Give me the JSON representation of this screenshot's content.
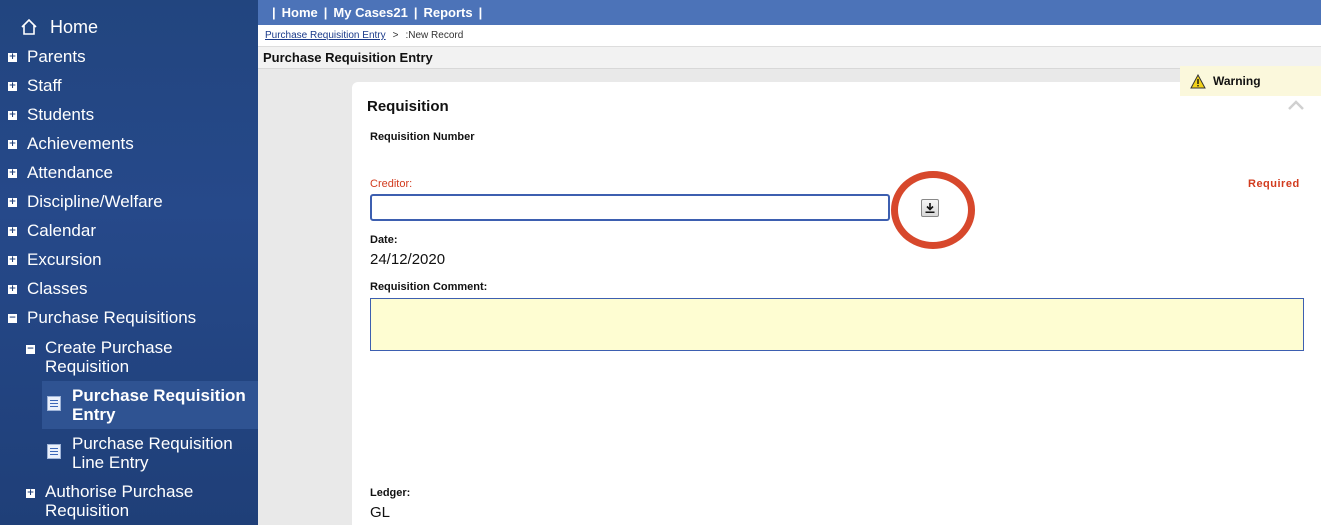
{
  "sidebar": {
    "home": "Home",
    "items": [
      {
        "label": "Parents",
        "toggle": "+"
      },
      {
        "label": "Staff",
        "toggle": "+"
      },
      {
        "label": "Students",
        "toggle": "+"
      },
      {
        "label": "Achievements",
        "toggle": "+"
      },
      {
        "label": "Attendance",
        "toggle": "+"
      },
      {
        "label": "Discipline/Welfare",
        "toggle": "+"
      },
      {
        "label": "Calendar",
        "toggle": "+"
      },
      {
        "label": "Excursion",
        "toggle": "+"
      },
      {
        "label": "Classes",
        "toggle": "+"
      },
      {
        "label": "Purchase Requisitions",
        "toggle": "−"
      }
    ],
    "sub": {
      "create": {
        "label": "Create Purchase Requisition",
        "toggle": "−"
      },
      "leaves": [
        {
          "label": "Purchase Requisition Entry",
          "active": true
        },
        {
          "label": "Purchase Requisition Line Entry",
          "active": false
        }
      ],
      "authorise": {
        "label": "Authorise Purchase Requisition",
        "toggle": "+"
      }
    }
  },
  "topnav": {
    "sep": "|",
    "home": "Home",
    "my_cases": "My Cases21",
    "reports": "Reports"
  },
  "breadcrumb": {
    "link": "Purchase Requisition Entry",
    "sep": ">",
    "current": ":New Record"
  },
  "page_title": "Purchase Requisition Entry",
  "warning": {
    "label": "Warning",
    "icon": "warning-icon"
  },
  "form": {
    "section_title": "Requisition",
    "req_number_label": "Requisition Number",
    "creditor_label": "Creditor:",
    "creditor_value": "",
    "required_text": "Required",
    "date_label": "Date:",
    "date_value": "24/12/2020",
    "comment_label": "Requisition Comment:",
    "comment_value": "",
    "ledger_label": "Ledger:",
    "ledger_value": "GL"
  },
  "colors": {
    "sidebar": "#22457f",
    "topbar": "#4c73b8",
    "required": "#d23b1e",
    "highlight": "#d7482c",
    "comment_bg": "#fefdd2"
  }
}
